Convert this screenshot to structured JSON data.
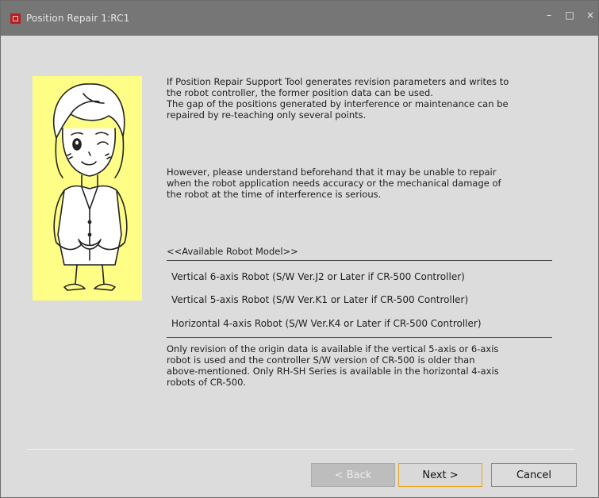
{
  "window": {
    "title": "Position Repair 1:RC1",
    "minimize": "–",
    "maximize": "□",
    "close": "×"
  },
  "content": {
    "para1": "If Position Repair Support Tool generates revision parameters and writes to\nthe robot controller, the former position data can be used.\nThe gap of the positions generated by interference or maintenance can be\nrepaired by re-teaching only several points.",
    "para2": "However, please understand beforehand that it may be unable to repair\nwhen the robot application needs accuracy or the mechanical damage of\nthe robot at the time of interference is serious.",
    "models_header": "<<Available Robot Model>>",
    "models": [
      "Vertical 6-axis Robot (S/W Ver.J2 or Later if CR-500 Controller)",
      "Vertical 5-axis Robot (S/W Ver.K1 or Later if CR-500 Controller)",
      "Horizontal 4-axis Robot (S/W Ver.K4 or Later if CR-500 Controller)"
    ],
    "note": "Only revision of the origin data is available if the vertical 5-axis or 6-axis\nrobot is used and the controller S/W version of CR-500 is older than\nabove-mentioned. Only RH-SH Series is available in the horizontal 4-axis\nrobots of CR-500."
  },
  "buttons": {
    "back": "< Back",
    "next": "Next >",
    "cancel": "Cancel"
  },
  "colors": {
    "mascot_bg": "#fefe87",
    "titlebar": "#767676",
    "dialog_bg": "#dcdcdc",
    "focus_border": "#e8a622"
  },
  "icons": [
    "app-icon",
    "mascot-illustration"
  ]
}
